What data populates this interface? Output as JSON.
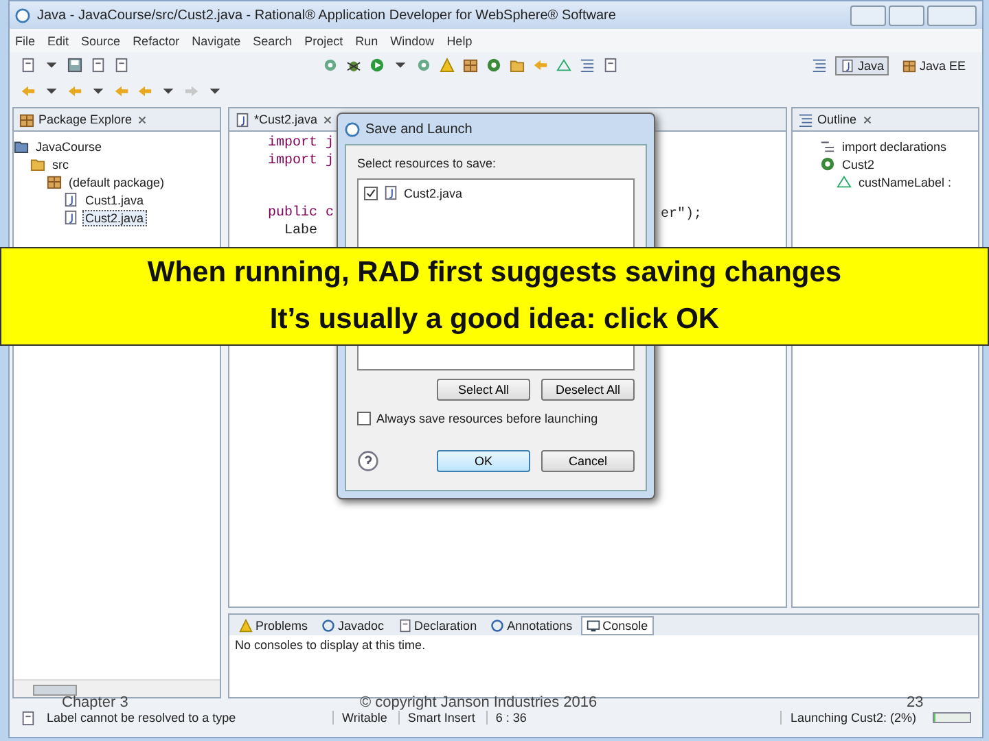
{
  "window": {
    "title": "Java - JavaCourse/src/Cust2.java - Rational® Application Developer for WebSphere® Software"
  },
  "menu": [
    "File",
    "Edit",
    "Source",
    "Refactor",
    "Navigate",
    "Search",
    "Project",
    "Run",
    "Window",
    "Help"
  ],
  "perspectives": [
    {
      "label": "Java",
      "selected": true
    },
    {
      "label": "Java EE",
      "selected": false
    }
  ],
  "package_explorer": {
    "tab": "Package Explore",
    "tree": [
      {
        "label": "JavaCourse",
        "kind": "project",
        "selected": false,
        "children": [
          {
            "label": "src",
            "kind": "folder",
            "selected": false,
            "children": [
              {
                "label": "(default package)",
                "kind": "package",
                "selected": false,
                "children": [
                  {
                    "label": "Cust1.java",
                    "kind": "file",
                    "selected": false
                  },
                  {
                    "label": "Cust2.java",
                    "kind": "file",
                    "selected": true
                  }
                ]
              }
            ]
          }
        ]
      }
    ]
  },
  "editor": {
    "tab": "*Cust2.java",
    "lines": [
      "import j",
      "import j",
      "public c",
      "Labe"
    ],
    "line_tail": "er\");"
  },
  "outline": {
    "tab": "Outline",
    "items": [
      {
        "label": "import declarations",
        "kind": "imports"
      },
      {
        "label": "Cust2",
        "kind": "class",
        "children": [
          {
            "label": "custNameLabel :",
            "kind": "field"
          }
        ]
      }
    ]
  },
  "dialog": {
    "title": "Save and Launch",
    "prompt": "Select resources to save:",
    "resources": [
      {
        "label": "Cust2.java",
        "checked": true
      }
    ],
    "list_buttons": [
      "Select All",
      "Deselect All"
    ],
    "always_save": {
      "label": "Always save resources before launching",
      "checked": false
    },
    "ok": "OK",
    "cancel": "Cancel"
  },
  "console": {
    "tabs": [
      {
        "label": "Problems",
        "selected": false
      },
      {
        "label": "Javadoc",
        "selected": false
      },
      {
        "label": "Declaration",
        "selected": false
      },
      {
        "label": "Annotations",
        "selected": false
      },
      {
        "label": "Console",
        "selected": true
      }
    ],
    "message": "No consoles to display at this time."
  },
  "status_bar": {
    "message": "Label cannot be resolved to a type",
    "fields": [
      "Writable",
      "Smart Insert",
      "6 : 36"
    ],
    "progress": {
      "label": "Launching Cust2: (2%)",
      "level": 0.02
    }
  },
  "callout": {
    "lines": [
      "When running, RAD first suggests saving changes",
      "It’s usually a good idea: click OK"
    ]
  },
  "footer": {
    "chapter": "Chapter 3",
    "copyright": "© copyright Janson Industries 2016",
    "page": "23"
  }
}
